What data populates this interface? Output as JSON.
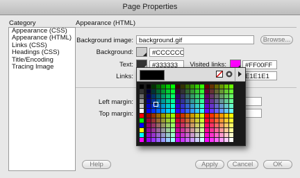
{
  "window": {
    "title": "Page Properties"
  },
  "category": {
    "label": "Category",
    "items": [
      "Appearance (CSS)",
      "Appearance (HTML)",
      "Links (CSS)",
      "Headings (CSS)",
      "Title/Encoding",
      "Tracing Image"
    ]
  },
  "section": {
    "title": "Appearance (HTML)"
  },
  "form": {
    "background_image_label": "Background image:",
    "background_image_value": "background.gif",
    "browse_label": "Browse...",
    "background_label": "Background:",
    "background_value": "#CCCCCC",
    "background_color": "#CCCCCC",
    "text_label": "Text:",
    "text_value": "#333333",
    "text_color": "#333333",
    "visited_links_label": "Visited links:",
    "visited_links_value": "#FF00FF",
    "visited_links_color": "#FF00FF",
    "links_label": "Links:",
    "links_value": "E1E1E1",
    "left_margin_label": "Left margin:",
    "top_margin_label": "Top margin:"
  },
  "picker": {
    "preview_color": "#000000",
    "hex_value": "",
    "icons": [
      "no-color-icon",
      "color-wheel-icon",
      "menu-arrow-icon"
    ]
  },
  "buttons": {
    "help": "Help",
    "apply": "Apply",
    "cancel": "Cancel",
    "ok": "OK"
  }
}
